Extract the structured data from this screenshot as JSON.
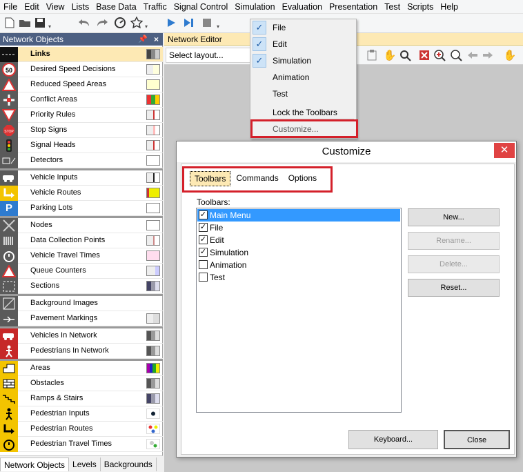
{
  "menubar": {
    "items": [
      "File",
      "Edit",
      "View",
      "Lists",
      "Base Data",
      "Traffic",
      "Signal Control",
      "Simulation",
      "Evaluation",
      "Presentation",
      "Test",
      "Scripts",
      "Help"
    ]
  },
  "left_panel": {
    "title": "Network Objects",
    "pin_icon": "pin-icon",
    "close_glyph": "×",
    "rows": [
      {
        "label": "Links",
        "icon": "links-icon",
        "selected": true
      },
      {
        "label": "Desired Speed Decisions",
        "icon": "speed-50-icon"
      },
      {
        "label": "Reduced Speed Areas",
        "icon": "warning-triangle-icon"
      },
      {
        "label": "Conflict Areas",
        "icon": "conflict-areas-icon"
      },
      {
        "label": "Priority Rules",
        "icon": "yield-icon"
      },
      {
        "label": "Stop Signs",
        "icon": "stop-sign-icon"
      },
      {
        "label": "Signal Heads",
        "icon": "traffic-light-icon"
      },
      {
        "label": "Detectors",
        "icon": "detector-icon"
      },
      {
        "label": "Vehicle Inputs",
        "icon": "vehicle-input-icon"
      },
      {
        "label": "Vehicle Routes",
        "icon": "vehicle-route-icon"
      },
      {
        "label": "Parking Lots",
        "icon": "parking-icon"
      },
      {
        "label": "Nodes",
        "icon": "nodes-icon"
      },
      {
        "label": "Data Collection Points",
        "icon": "data-collection-icon"
      },
      {
        "label": "Vehicle Travel Times",
        "icon": "stopwatch-icon"
      },
      {
        "label": "Queue Counters",
        "icon": "queue-counter-icon"
      },
      {
        "label": "Sections",
        "icon": "sections-icon"
      },
      {
        "label": "Background Images",
        "icon": "background-image-icon"
      },
      {
        "label": "Pavement Markings",
        "icon": "pavement-marking-icon"
      },
      {
        "label": "Vehicles In Network",
        "icon": "vehicles-in-network-icon"
      },
      {
        "label": "Pedestrians In Network",
        "icon": "pedestrians-in-network-icon"
      },
      {
        "label": "Areas",
        "icon": "areas-icon"
      },
      {
        "label": "Obstacles",
        "icon": "obstacles-icon"
      },
      {
        "label": "Ramps & Stairs",
        "icon": "ramps-stairs-icon"
      },
      {
        "label": "Pedestrian Inputs",
        "icon": "pedestrian-input-icon"
      },
      {
        "label": "Pedestrian Routes",
        "icon": "pedestrian-route-icon"
      },
      {
        "label": "Pedestrian Travel Times",
        "icon": "pedestrian-stopwatch-icon"
      }
    ],
    "bottom_tabs": [
      "Network Objects",
      "Levels",
      "Backgrounds"
    ]
  },
  "network_editor": {
    "title": "Network Editor",
    "layout_select": "Select layout..."
  },
  "toolbars_menu": {
    "items": [
      {
        "label": "File",
        "checked": true
      },
      {
        "label": "Edit",
        "checked": true
      },
      {
        "label": "Simulation",
        "checked": true
      },
      {
        "label": "Animation",
        "checked": false
      },
      {
        "label": "Test",
        "checked": false
      },
      {
        "label": "Lock the Toolbars",
        "checked": false
      },
      {
        "label": "Customize...",
        "checked": false
      }
    ],
    "check_glyph": "✓"
  },
  "dialog": {
    "title": "Customize",
    "close_glyph": "✕",
    "tabs": [
      "Toolbars",
      "Commands",
      "Options"
    ],
    "toolbars_label": "Toolbars:",
    "toolbars": [
      {
        "label": "Main Menu",
        "checked": true,
        "selected": true
      },
      {
        "label": "File",
        "checked": true
      },
      {
        "label": "Edit",
        "checked": true
      },
      {
        "label": "Simulation",
        "checked": true
      },
      {
        "label": "Animation",
        "checked": false
      },
      {
        "label": "Test",
        "checked": false
      }
    ],
    "buttons": {
      "new": "New...",
      "rename": "Rename...",
      "delete": "Delete...",
      "reset": "Reset...",
      "keyboard": "Keyboard...",
      "close": "Close"
    },
    "check_glyph": "✓"
  },
  "colors": {
    "highlight_red": "#d4202a",
    "panel_header": "#4d6082",
    "selection_yellow": "#fde9b4",
    "list_selection": "#3399ff"
  }
}
